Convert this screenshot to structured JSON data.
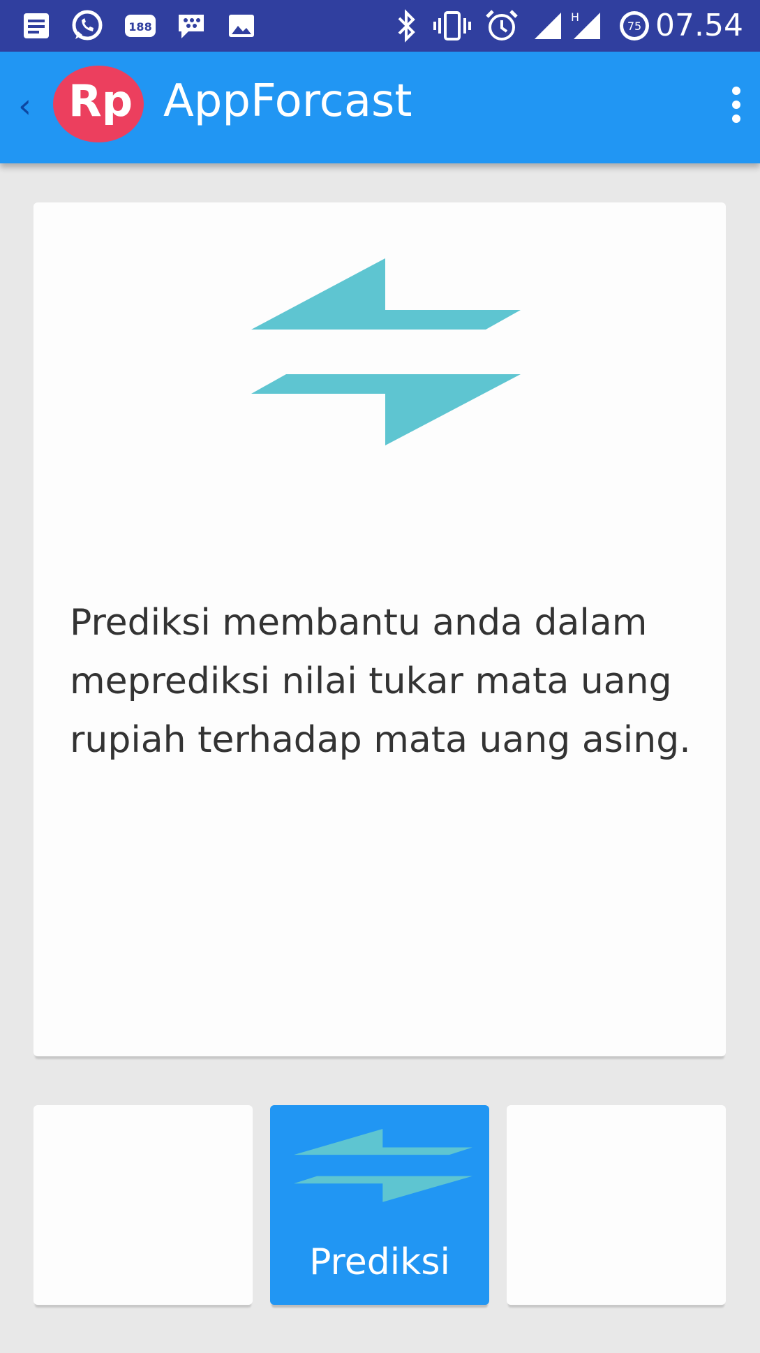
{
  "status_bar": {
    "time": "07.54",
    "battery_level": "75",
    "badge_188": "188",
    "network_type": "H",
    "icons": [
      "notes-icon",
      "whatsapp-icon",
      "notification-188-icon",
      "bbm-icon",
      "gallery-icon",
      "bluetooth-icon",
      "vibrate-icon",
      "alarm-icon",
      "signal-icon",
      "signal-h-icon",
      "battery-icon"
    ]
  },
  "app_bar": {
    "back_glyph": "‹",
    "logo_text": "Rp",
    "title": "AppForcast",
    "menu_icon": "more-vert-icon"
  },
  "card": {
    "icon": "swap-arrows-icon",
    "icon_color": "#5ec5d1",
    "description": "Prediksi membantu anda dalam\nmeprediksi nilai tukar mata uang\n rupiah terhadap mata uang asing."
  },
  "tiles": [
    {
      "label": "",
      "selected": false
    },
    {
      "label": "Prediksi",
      "selected": true,
      "icon": "swap-arrows-icon"
    },
    {
      "label": "",
      "selected": false
    }
  ],
  "colors": {
    "primary": "#2196f3",
    "status_bar": "#303f9f",
    "accent_logo": "#ec3f5e",
    "background": "#e8e8e8"
  }
}
